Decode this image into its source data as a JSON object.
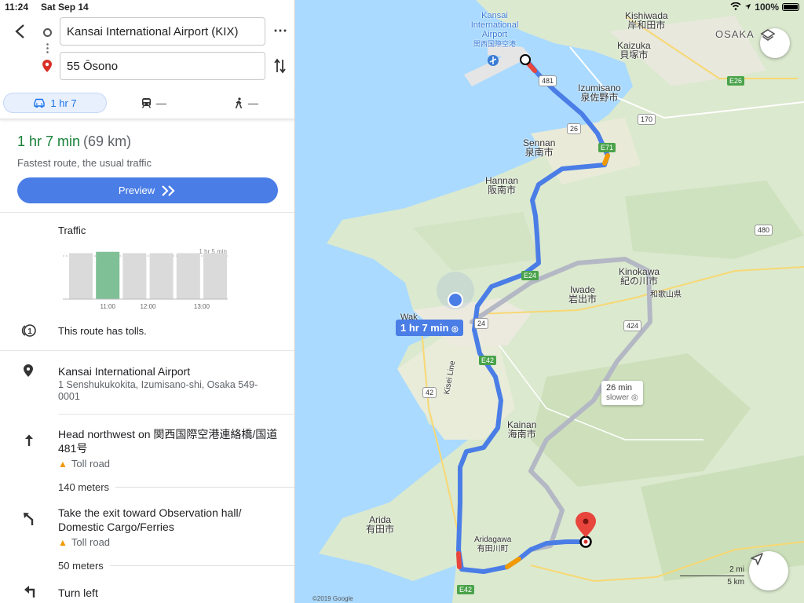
{
  "status": {
    "time": "11:24",
    "date": "Sat Sep 14",
    "battery": "100%"
  },
  "search": {
    "origin": "Kansai International Airport (KIX)",
    "destination": "55 Ōsono"
  },
  "modes": {
    "drive": "1 hr 7",
    "transit": "—",
    "walk": "—"
  },
  "route": {
    "duration": "1 hr 7 min",
    "distance": "(69 km)",
    "description": "Fastest route, the usual traffic",
    "preview_label": "Preview"
  },
  "traffic": {
    "label": "Traffic",
    "peak_label": "1 hr 5 min",
    "bars": [
      0.68,
      0.7,
      0.68,
      0.68,
      0.68,
      0.68
    ],
    "selected_index": 1,
    "ticks": [
      "11:00",
      "12:00",
      "13:00"
    ]
  },
  "tolls_text": "This route has tolls.",
  "start": {
    "name": "Kansai International Airport",
    "address": "1 Senshukukokita, Izumisano-shi, Osaka 549-0001"
  },
  "steps": [
    {
      "instruction": "Head northwest on 関西国際空港連絡橋/国道481号",
      "note": "Toll road",
      "distance": "140 meters"
    },
    {
      "instruction": "Take the exit toward Observation hall/ Domestic Cargo/Ferries",
      "note": "Toll road",
      "distance": "50 meters"
    },
    {
      "instruction": "Turn left"
    }
  ],
  "map": {
    "labels": {
      "kansai_airport": "Kansai International Airport",
      "kansai_airport_jp": "関西国際空港",
      "kishiwada": "Kishiwada",
      "kishiwada_jp": "岸和田市",
      "osaka": "OSAKA",
      "kaizuka": "Kaizuka",
      "kaizuka_jp": "貝塚市",
      "izumisano": "Izumisano",
      "izumisano_jp": "泉佐野市",
      "sennan": "Sennan",
      "sennan_jp": "泉南市",
      "hannan": "Hannan",
      "hannan_jp": "阪南市",
      "kinokawa": "Kinokawa",
      "kinokawa_jp": "紀の川市",
      "iwade": "Iwade",
      "iwade_jp": "岩出市",
      "wakayama_pref": "和歌山県",
      "kainan": "Kainan",
      "kainan_jp": "海南市",
      "arida": "Arida",
      "arida_jp": "有田市",
      "aridagawa": "Aridagawa",
      "aridagawa_jp": "有田川町",
      "kisei_line": "Kisei Line",
      "wak": "Wak"
    },
    "shields": [
      "481",
      "26",
      "170",
      "E26",
      "E71",
      "E24",
      "24",
      "480",
      "424",
      "E42",
      "42",
      "E42"
    ],
    "main_callout": "1 hr 7 min",
    "alt_callout": {
      "time": "26 min",
      "note": "slower"
    },
    "scale": {
      "mi": "2 mi",
      "km": "5 km"
    },
    "copyright": "©2019 Google",
    "colors": {
      "route": "#4a7de6",
      "alt": "#b4b8c4",
      "water": "#aadaff",
      "land": "#dbe9cf"
    }
  }
}
